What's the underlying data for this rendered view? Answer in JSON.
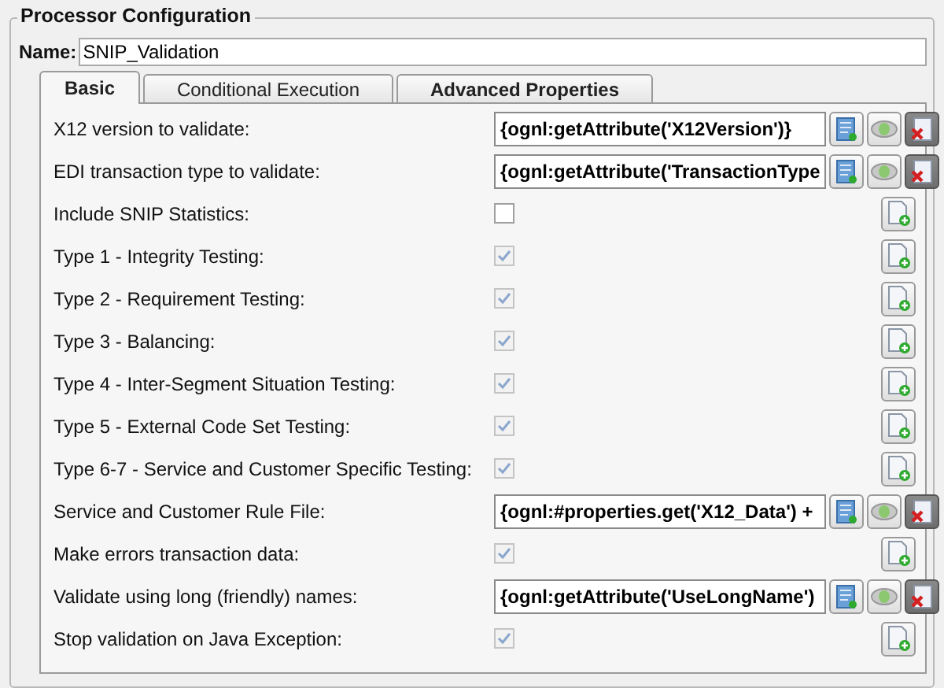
{
  "group_title": "Processor Configuration",
  "name": {
    "label": "Name:",
    "value": "SNIP_Validation"
  },
  "tabs": [
    {
      "label": "Basic",
      "selected": true
    },
    {
      "label": "Conditional Execution",
      "selected": false
    },
    {
      "label": "Advanced Properties",
      "selected": false
    }
  ],
  "properties": [
    {
      "kind": "expression",
      "label": "X12 version to validate:",
      "value": "{ognl:getAttribute('X12Version')}"
    },
    {
      "kind": "expression",
      "label": "EDI transaction type to validate:",
      "value": "{ognl:getAttribute('TransactionType"
    },
    {
      "kind": "checkbox",
      "label": "Include SNIP Statistics:",
      "checked": false
    },
    {
      "kind": "checkbox",
      "label": "Type 1 - Integrity Testing:",
      "checked": true
    },
    {
      "kind": "checkbox",
      "label": "Type 2 - Requirement Testing:",
      "checked": true
    },
    {
      "kind": "checkbox",
      "label": "Type 3 - Balancing:",
      "checked": true
    },
    {
      "kind": "checkbox",
      "label": "Type 4 - Inter-Segment Situation Testing:",
      "checked": true
    },
    {
      "kind": "checkbox",
      "label": "Type 5 - External Code Set Testing:",
      "checked": true
    },
    {
      "kind": "checkbox",
      "label": "Type 6-7 - Service and Customer Specific Testing:",
      "checked": true
    },
    {
      "kind": "expression",
      "label": "Service and Customer Rule File:",
      "value": "{ognl:#properties.get('X12_Data') +"
    },
    {
      "kind": "checkbox",
      "label": "Make errors transaction data:",
      "checked": true
    },
    {
      "kind": "expression",
      "label": "Validate using long (friendly) names:",
      "value": "{ognl:getAttribute('UseLongName')"
    },
    {
      "kind": "checkbox",
      "label": "Stop validation on Java Exception:",
      "checked": true
    }
  ]
}
